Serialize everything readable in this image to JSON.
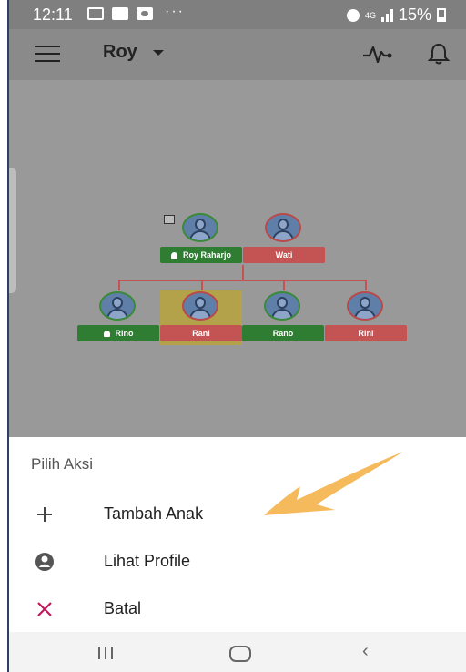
{
  "status_bar": {
    "time": "12:11",
    "network": "4G",
    "battery": "15%"
  },
  "app_bar": {
    "title": "Roy",
    "icons": [
      "menu-icon",
      "dropdown-caret-icon",
      "activity-pulse-icon",
      "bell-icon"
    ]
  },
  "tree": {
    "parents": [
      {
        "name": "Roy Raharjo",
        "gender": "male",
        "has_profile_icon": true
      },
      {
        "name": "Wati",
        "gender": "female",
        "has_profile_icon": false
      }
    ],
    "children": [
      {
        "name": "Rino",
        "gender": "male",
        "has_profile_icon": true,
        "selected": false
      },
      {
        "name": "Rani",
        "gender": "female",
        "has_profile_icon": false,
        "selected": true
      },
      {
        "name": "Rano",
        "gender": "male",
        "has_profile_icon": false,
        "selected": false
      },
      {
        "name": "Rini",
        "gender": "female",
        "has_profile_icon": false,
        "selected": false
      }
    ],
    "colors": {
      "male": "#2e7d32",
      "female": "#c45454",
      "selected": "#b3a24a"
    }
  },
  "sheet": {
    "title": "Pilih Aksi",
    "actions": [
      {
        "label": "Tambah Anak",
        "icon": "plus-icon"
      },
      {
        "label": "Lihat Profile",
        "icon": "account-circle-icon"
      },
      {
        "label": "Batal",
        "icon": "close-icon",
        "icon_color": "#c2185b"
      }
    ]
  },
  "nav_bar": {
    "icons": [
      "recent-apps-icon",
      "home-icon",
      "back-icon"
    ]
  }
}
